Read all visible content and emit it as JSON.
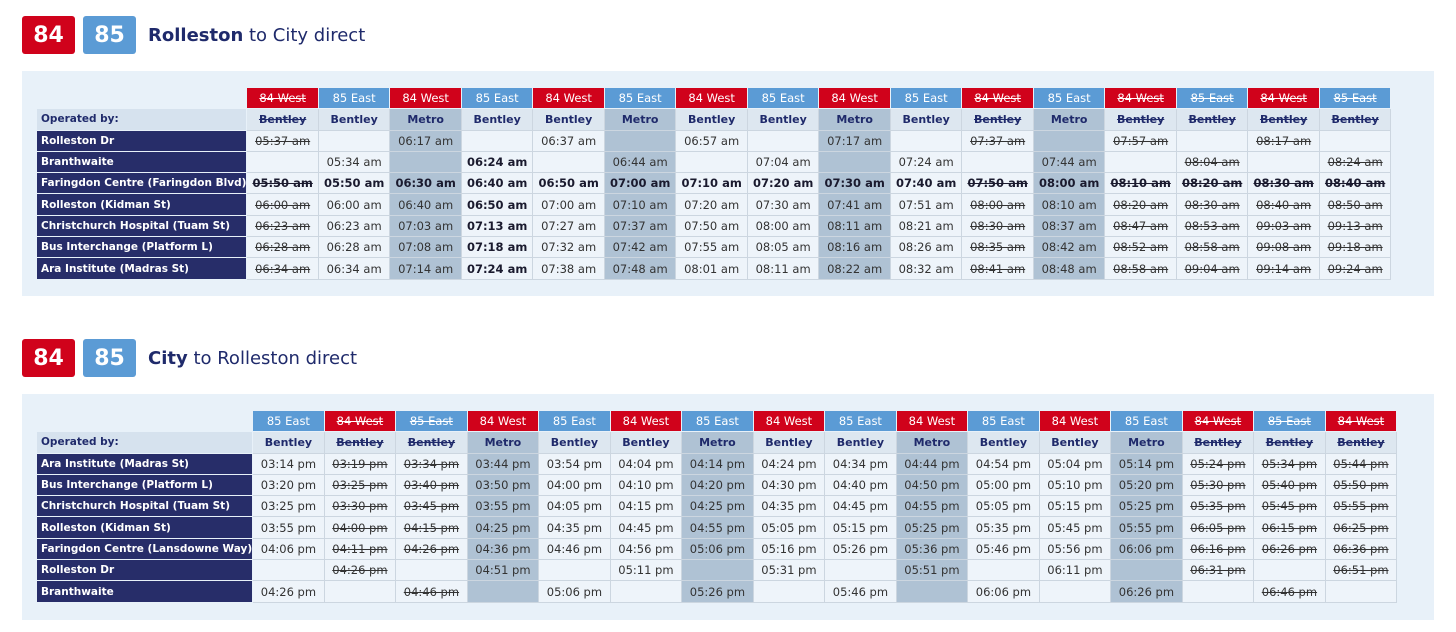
{
  "sections": [
    {
      "badges": [
        "84",
        "85"
      ],
      "title_bold": "Rolleston",
      "title_rest": " to City direct",
      "operated_label": "Operated by:",
      "columns": [
        {
          "route": "84 West",
          "dir": "west",
          "operator": "Bentley",
          "metro": false,
          "struck": true
        },
        {
          "route": "85 East",
          "dir": "east",
          "operator": "Bentley",
          "metro": false,
          "struck": false
        },
        {
          "route": "84 West",
          "dir": "west",
          "operator": "Metro",
          "metro": true,
          "struck": false
        },
        {
          "route": "85 East",
          "dir": "east",
          "operator": "Bentley",
          "metro": false,
          "struck": false
        },
        {
          "route": "84 West",
          "dir": "west",
          "operator": "Bentley",
          "metro": false,
          "struck": false
        },
        {
          "route": "85 East",
          "dir": "east",
          "operator": "Metro",
          "metro": true,
          "struck": false
        },
        {
          "route": "84 West",
          "dir": "west",
          "operator": "Bentley",
          "metro": false,
          "struck": false
        },
        {
          "route": "85 East",
          "dir": "east",
          "operator": "Bentley",
          "metro": false,
          "struck": false
        },
        {
          "route": "84 West",
          "dir": "west",
          "operator": "Metro",
          "metro": true,
          "struck": false
        },
        {
          "route": "85 East",
          "dir": "east",
          "operator": "Bentley",
          "metro": false,
          "struck": false
        },
        {
          "route": "84 West",
          "dir": "west",
          "operator": "Bentley",
          "metro": false,
          "struck": true
        },
        {
          "route": "85 East",
          "dir": "east",
          "operator": "Metro",
          "metro": true,
          "struck": false
        },
        {
          "route": "84 West",
          "dir": "west",
          "operator": "Bentley",
          "metro": false,
          "struck": true
        },
        {
          "route": "85 East",
          "dir": "east",
          "operator": "Bentley",
          "metro": false,
          "struck": true
        },
        {
          "route": "84 West",
          "dir": "west",
          "operator": "Bentley",
          "metro": false,
          "struck": true
        },
        {
          "route": "85 East",
          "dir": "east",
          "operator": "Bentley",
          "metro": false,
          "struck": true
        }
      ],
      "rows": [
        {
          "stop": "Rolleston Dr",
          "bold": false,
          "times": [
            "05:37 am",
            "",
            "06:17 am",
            "",
            "06:37 am",
            "",
            "06:57 am",
            "",
            "07:17 am",
            "",
            "07:37 am",
            "",
            "07:57 am",
            "",
            "08:17 am",
            ""
          ]
        },
        {
          "stop": "Branthwaite",
          "bold": false,
          "times": [
            "",
            "05:34 am",
            "",
            "06:24 am",
            "",
            "06:44 am",
            "",
            "07:04 am",
            "",
            "07:24 am",
            "",
            "07:44 am",
            "",
            "08:04 am",
            "",
            "08:24 am"
          ]
        },
        {
          "stop": "Faringdon Centre (Faringdon Blvd)",
          "bold": true,
          "times": [
            "05:50 am",
            "05:50 am",
            "06:30 am",
            "06:40 am",
            "06:50 am",
            "07:00 am",
            "07:10 am",
            "07:20 am",
            "07:30 am",
            "07:40 am",
            "07:50 am",
            "08:00 am",
            "08:10 am",
            "08:20 am",
            "08:30 am",
            "08:40 am"
          ]
        },
        {
          "stop": "Rolleston (Kidman St)",
          "bold": false,
          "times": [
            "06:00 am",
            "06:00 am",
            "06:40 am",
            "06:50 am",
            "07:00 am",
            "07:10 am",
            "07:20 am",
            "07:30 am",
            "07:41 am",
            "07:51 am",
            "08:00 am",
            "08:10 am",
            "08:20 am",
            "08:30 am",
            "08:40 am",
            "08:50 am"
          ]
        },
        {
          "stop": "Christchurch Hospital (Tuam St)",
          "bold": false,
          "times": [
            "06:23 am",
            "06:23 am",
            "07:03 am",
            "07:13 am",
            "07:27 am",
            "07:37 am",
            "07:50 am",
            "08:00 am",
            "08:11 am",
            "08:21 am",
            "08:30 am",
            "08:37 am",
            "08:47 am",
            "08:53 am",
            "09:03 am",
            "09:13 am"
          ]
        },
        {
          "stop": "Bus Interchange (Platform L)",
          "bold": false,
          "times": [
            "06:28 am",
            "06:28 am",
            "07:08 am",
            "07:18 am",
            "07:32 am",
            "07:42 am",
            "07:55 am",
            "08:05 am",
            "08:16 am",
            "08:26 am",
            "08:35 am",
            "08:42 am",
            "08:52 am",
            "08:58 am",
            "09:08 am",
            "09:18 am"
          ]
        },
        {
          "stop": "Ara Institute (Madras St)",
          "bold": false,
          "times": [
            "06:34 am",
            "06:34 am",
            "07:14 am",
            "07:24 am",
            "07:38 am",
            "07:48 am",
            "08:01 am",
            "08:11 am",
            "08:22 am",
            "08:32 am",
            "08:41 am",
            "08:48 am",
            "08:58 am",
            "09:04 am",
            "09:14 am",
            "09:24 am"
          ]
        }
      ],
      "bold_cells": [
        [
          1,
          3
        ],
        [
          2,
          3
        ],
        [
          3,
          3
        ],
        [
          4,
          3
        ],
        [
          5,
          3
        ],
        [
          6,
          3
        ]
      ]
    },
    {
      "badges": [
        "84",
        "85"
      ],
      "title_bold": "City",
      "title_rest": " to Rolleston direct",
      "operated_label": "Operated by:",
      "columns": [
        {
          "route": "85 East",
          "dir": "east",
          "operator": "Bentley",
          "metro": false,
          "struck": false
        },
        {
          "route": "84 West",
          "dir": "west",
          "operator": "Bentley",
          "metro": false,
          "struck": true
        },
        {
          "route": "85 East",
          "dir": "east",
          "operator": "Bentley",
          "metro": false,
          "struck": true
        },
        {
          "route": "84 West",
          "dir": "west",
          "operator": "Metro",
          "metro": true,
          "struck": false
        },
        {
          "route": "85 East",
          "dir": "east",
          "operator": "Bentley",
          "metro": false,
          "struck": false
        },
        {
          "route": "84 West",
          "dir": "west",
          "operator": "Bentley",
          "metro": false,
          "struck": false
        },
        {
          "route": "85 East",
          "dir": "east",
          "operator": "Metro",
          "metro": true,
          "struck": false
        },
        {
          "route": "84 West",
          "dir": "west",
          "operator": "Bentley",
          "metro": false,
          "struck": false
        },
        {
          "route": "85 East",
          "dir": "east",
          "operator": "Bentley",
          "metro": false,
          "struck": false
        },
        {
          "route": "84 West",
          "dir": "west",
          "operator": "Metro",
          "metro": true,
          "struck": false
        },
        {
          "route": "85 East",
          "dir": "east",
          "operator": "Bentley",
          "metro": false,
          "struck": false
        },
        {
          "route": "84 West",
          "dir": "west",
          "operator": "Bentley",
          "metro": false,
          "struck": false
        },
        {
          "route": "85 East",
          "dir": "east",
          "operator": "Metro",
          "metro": true,
          "struck": false
        },
        {
          "route": "84 West",
          "dir": "west",
          "operator": "Bentley",
          "metro": false,
          "struck": true
        },
        {
          "route": "85 East",
          "dir": "east",
          "operator": "Bentley",
          "metro": false,
          "struck": true
        },
        {
          "route": "84 West",
          "dir": "west",
          "operator": "Bentley",
          "metro": false,
          "struck": true
        }
      ],
      "rows": [
        {
          "stop": "Ara Institute (Madras St)",
          "bold": false,
          "times": [
            "03:14 pm",
            "03:19 pm",
            "03:34 pm",
            "03:44 pm",
            "03:54 pm",
            "04:04 pm",
            "04:14 pm",
            "04:24 pm",
            "04:34 pm",
            "04:44 pm",
            "04:54 pm",
            "05:04 pm",
            "05:14 pm",
            "05:24 pm",
            "05:34 pm",
            "05:44 pm"
          ]
        },
        {
          "stop": "Bus Interchange (Platform L)",
          "bold": false,
          "times": [
            "03:20 pm",
            "03:25 pm",
            "03:40 pm",
            "03:50 pm",
            "04:00 pm",
            "04:10 pm",
            "04:20 pm",
            "04:30 pm",
            "04:40 pm",
            "04:50 pm",
            "05:00 pm",
            "05:10 pm",
            "05:20 pm",
            "05:30 pm",
            "05:40 pm",
            "05:50 pm"
          ]
        },
        {
          "stop": "Christchurch Hospital (Tuam St)",
          "bold": false,
          "times": [
            "03:25 pm",
            "03:30 pm",
            "03:45 pm",
            "03:55 pm",
            "04:05 pm",
            "04:15 pm",
            "04:25 pm",
            "04:35 pm",
            "04:45 pm",
            "04:55 pm",
            "05:05 pm",
            "05:15 pm",
            "05:25 pm",
            "05:35 pm",
            "05:45 pm",
            "05:55 pm"
          ]
        },
        {
          "stop": "Rolleston (Kidman St)",
          "bold": false,
          "times": [
            "03:55 pm",
            "04:00 pm",
            "04:15 pm",
            "04:25 pm",
            "04:35 pm",
            "04:45 pm",
            "04:55 pm",
            "05:05 pm",
            "05:15 pm",
            "05:25 pm",
            "05:35 pm",
            "05:45 pm",
            "05:55 pm",
            "06:05 pm",
            "06:15 pm",
            "06:25 pm"
          ]
        },
        {
          "stop": "Faringdon Centre (Lansdowne Way)",
          "bold": false,
          "times": [
            "04:06 pm",
            "04:11 pm",
            "04:26 pm",
            "04:36 pm",
            "04:46 pm",
            "04:56 pm",
            "05:06 pm",
            "05:16 pm",
            "05:26 pm",
            "05:36 pm",
            "05:46 pm",
            "05:56 pm",
            "06:06 pm",
            "06:16 pm",
            "06:26 pm",
            "06:36 pm"
          ]
        },
        {
          "stop": "Rolleston Dr",
          "bold": false,
          "times": [
            "",
            "04:26 pm",
            "",
            "04:51 pm",
            "",
            "05:11 pm",
            "",
            "05:31 pm",
            "",
            "05:51 pm",
            "",
            "06:11 pm",
            "",
            "06:31 pm",
            "",
            "06:51 pm"
          ]
        },
        {
          "stop": "Branthwaite",
          "bold": false,
          "times": [
            "04:26 pm",
            "",
            "04:46 pm",
            "",
            "05:06 pm",
            "",
            "05:26 pm",
            "",
            "05:46 pm",
            "",
            "06:06 pm",
            "",
            "06:26 pm",
            "",
            "06:46 pm",
            ""
          ]
        }
      ],
      "bold_cells": []
    }
  ]
}
